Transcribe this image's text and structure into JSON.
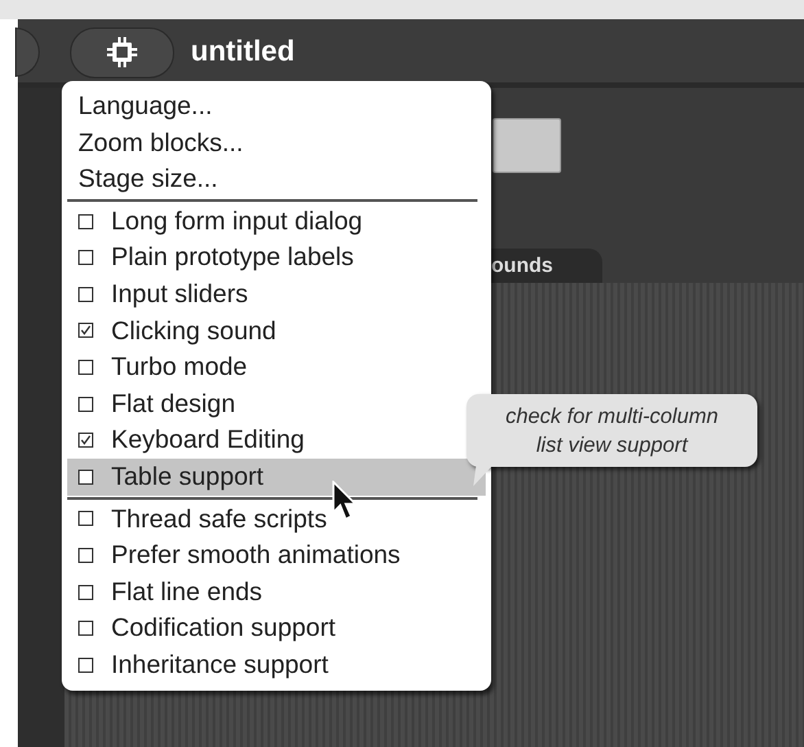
{
  "top_bar": {
    "project_title": "untitled"
  },
  "background": {
    "tab_label": "ounds"
  },
  "menu": {
    "items": [
      {
        "kind": "action",
        "label": "Language...",
        "selected": false
      },
      {
        "kind": "action",
        "label": "Zoom blocks...",
        "selected": false
      },
      {
        "kind": "action",
        "label": "Stage size...",
        "selected": false
      },
      {
        "kind": "separator"
      },
      {
        "kind": "toggle",
        "label": "Long form input dialog",
        "checked": false,
        "selected": false
      },
      {
        "kind": "toggle",
        "label": "Plain prototype labels",
        "checked": false,
        "selected": false
      },
      {
        "kind": "toggle",
        "label": "Input sliders",
        "checked": false,
        "selected": false
      },
      {
        "kind": "toggle",
        "label": "Clicking sound",
        "checked": true,
        "selected": false
      },
      {
        "kind": "toggle",
        "label": "Turbo mode",
        "checked": false,
        "selected": false
      },
      {
        "kind": "toggle",
        "label": "Flat design",
        "checked": false,
        "selected": false
      },
      {
        "kind": "toggle",
        "label": "Keyboard Editing",
        "checked": true,
        "selected": false
      },
      {
        "kind": "toggle",
        "label": "Table support",
        "checked": false,
        "selected": true
      },
      {
        "kind": "separator"
      },
      {
        "kind": "toggle",
        "label": "Thread safe scripts",
        "checked": false,
        "selected": false
      },
      {
        "kind": "toggle",
        "label": "Prefer smooth animations",
        "checked": false,
        "selected": false
      },
      {
        "kind": "toggle",
        "label": "Flat line ends",
        "checked": false,
        "selected": false
      },
      {
        "kind": "toggle",
        "label": "Codification support",
        "checked": false,
        "selected": false
      },
      {
        "kind": "toggle",
        "label": "Inheritance support",
        "checked": false,
        "selected": false
      }
    ]
  },
  "tooltip": {
    "lines": [
      "check for multi-column",
      "list view support"
    ]
  }
}
